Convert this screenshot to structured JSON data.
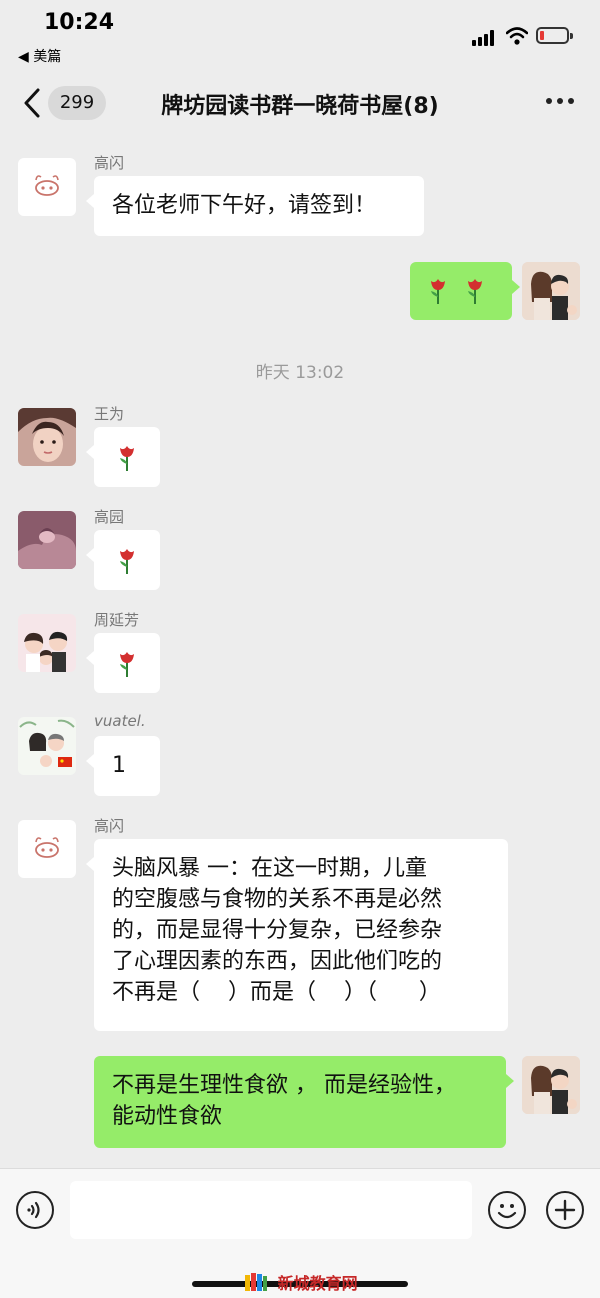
{
  "status_bar": {
    "time": "10:24",
    "back_app": "◀ 美篇",
    "battery_color": "#e53935"
  },
  "nav": {
    "unread_count": "299",
    "title": "牌坊园读书群一晓荷书屋(8)"
  },
  "messages": [
    {
      "sender": "高闪",
      "text": "各位老师下午好，请签到！",
      "side": "left",
      "avatar": "pig-icon"
    },
    {
      "sender": "",
      "text": "",
      "side": "right",
      "emoji": [
        "rose-icon",
        "rose-icon"
      ],
      "avatar": "couple-avatar"
    },
    {
      "sender": "王为",
      "text": "",
      "side": "left",
      "emoji": [
        "rose-icon"
      ],
      "avatar": "girl-photo-avatar"
    },
    {
      "sender": "高园",
      "text": "",
      "side": "left",
      "emoji": [
        "rose-icon"
      ],
      "avatar": "hands-photo-avatar"
    },
    {
      "sender": "周延芳",
      "text": "",
      "side": "left",
      "emoji": [
        "rose-icon"
      ],
      "avatar": "family-cartoon-avatar"
    },
    {
      "sender": "vuatel.",
      "text": "1",
      "side": "left",
      "avatar": "family-flag-avatar"
    },
    {
      "sender": "高闪",
      "lines": [
        "头脑风暴  一：在这一时期，儿童",
        "的空腹感与食物的关系不再是必然",
        "的，而是显得十分复杂，已经参杂",
        "了心理因素的东西，因此他们吃的",
        "不再是（    ）而是（    ）（      ）"
      ],
      "side": "left",
      "avatar": "pig-icon"
    },
    {
      "sender": "",
      "lines": [
        "不再是生理性食欲 ， 而是经验性，",
        "能动性食欲"
      ],
      "side": "right",
      "avatar": "couple-avatar"
    }
  ],
  "timestamp": "昨天 13:02",
  "input": {
    "placeholder": "",
    "value": ""
  },
  "watermark": "新城教育网",
  "colors": {
    "green_bubble": "#95ec69",
    "background": "#ededed"
  }
}
